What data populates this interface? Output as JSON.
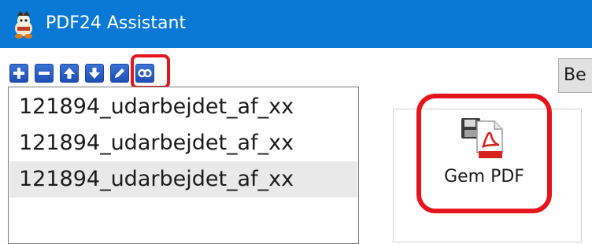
{
  "window": {
    "title": "PDF24 Assistant",
    "icon": "pdf24-mascot-icon"
  },
  "toolbar": {
    "buttons": [
      {
        "name": "add-icon"
      },
      {
        "name": "remove-icon"
      },
      {
        "name": "move-up-icon"
      },
      {
        "name": "move-down-icon"
      },
      {
        "name": "edit-icon"
      },
      {
        "name": "merge-icon"
      }
    ],
    "highlight_color": "#e5141d"
  },
  "file_list": {
    "items": [
      {
        "label": "121894_udarbejdet_af_xx",
        "selected": false
      },
      {
        "label": "121894_udarbejdet_af_xx",
        "selected": false
      },
      {
        "label": "121894_udarbejdet_af_xx",
        "selected": true
      }
    ]
  },
  "actions": {
    "partial_button_label": "Be",
    "save_pdf": {
      "label": "Gem PDF",
      "icon": "save-pdf-icon"
    }
  },
  "colors": {
    "titlebar": "#0a79d6",
    "accent_blue": "#2a5fc4",
    "highlight": "#e5141d"
  }
}
